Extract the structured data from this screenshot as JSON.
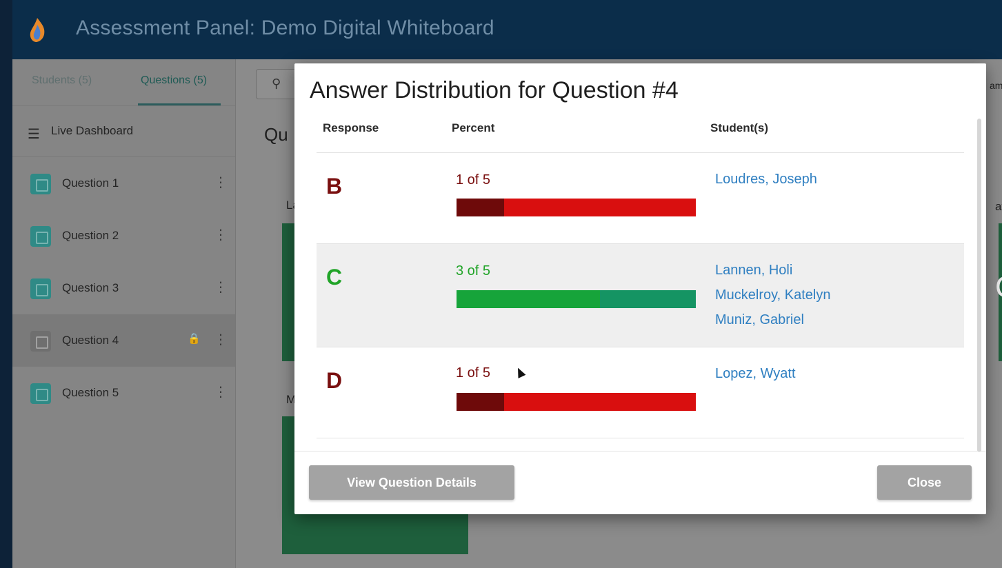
{
  "app": {
    "title": "Assessment Panel: Demo Digital Whiteboard"
  },
  "sidebar": {
    "tabs": [
      {
        "label": "Students (5)"
      },
      {
        "label": "Questions (5)"
      }
    ],
    "live_dashboard": "Live Dashboard",
    "questions": [
      {
        "label": "Question 1"
      },
      {
        "label": "Question 2"
      },
      {
        "label": "Question 3"
      },
      {
        "label": "Question 4"
      },
      {
        "label": "Question 5"
      }
    ]
  },
  "background": {
    "title_fragment": "Qu",
    "card1_label": "La",
    "card2_label": "Mu",
    "right_fragment1": "am",
    "right_fragment2": "at",
    "right_fragment3": "C"
  },
  "modal": {
    "title": "Answer Distribution for Question #4",
    "columns": {
      "response": "Response",
      "percent": "Percent",
      "students": "Student(s)"
    },
    "rows": [
      {
        "response": "B",
        "count_text": "1 of 5",
        "fraction": 0.2,
        "color": "#7a1010",
        "bar_fill": "#6e0a0a",
        "bar_rest": "#d90f0f",
        "students": [
          "Loudres, Joseph"
        ]
      },
      {
        "response": "C",
        "count_text": "3 of 5",
        "fraction": 0.6,
        "color": "#21a428",
        "bar_fill": "#16a43a",
        "bar_rest": "#159463",
        "students": [
          "Lannen, Holi",
          "Muckelroy, Katelyn",
          "Muniz, Gabriel"
        ]
      },
      {
        "response": "D",
        "count_text": "1 of 5",
        "fraction": 0.2,
        "color": "#7a1010",
        "bar_fill": "#6e0a0a",
        "bar_rest": "#d90f0f",
        "students": [
          "Lopez, Wyatt"
        ]
      }
    ],
    "buttons": {
      "details": "View Question Details",
      "close": "Close"
    }
  }
}
